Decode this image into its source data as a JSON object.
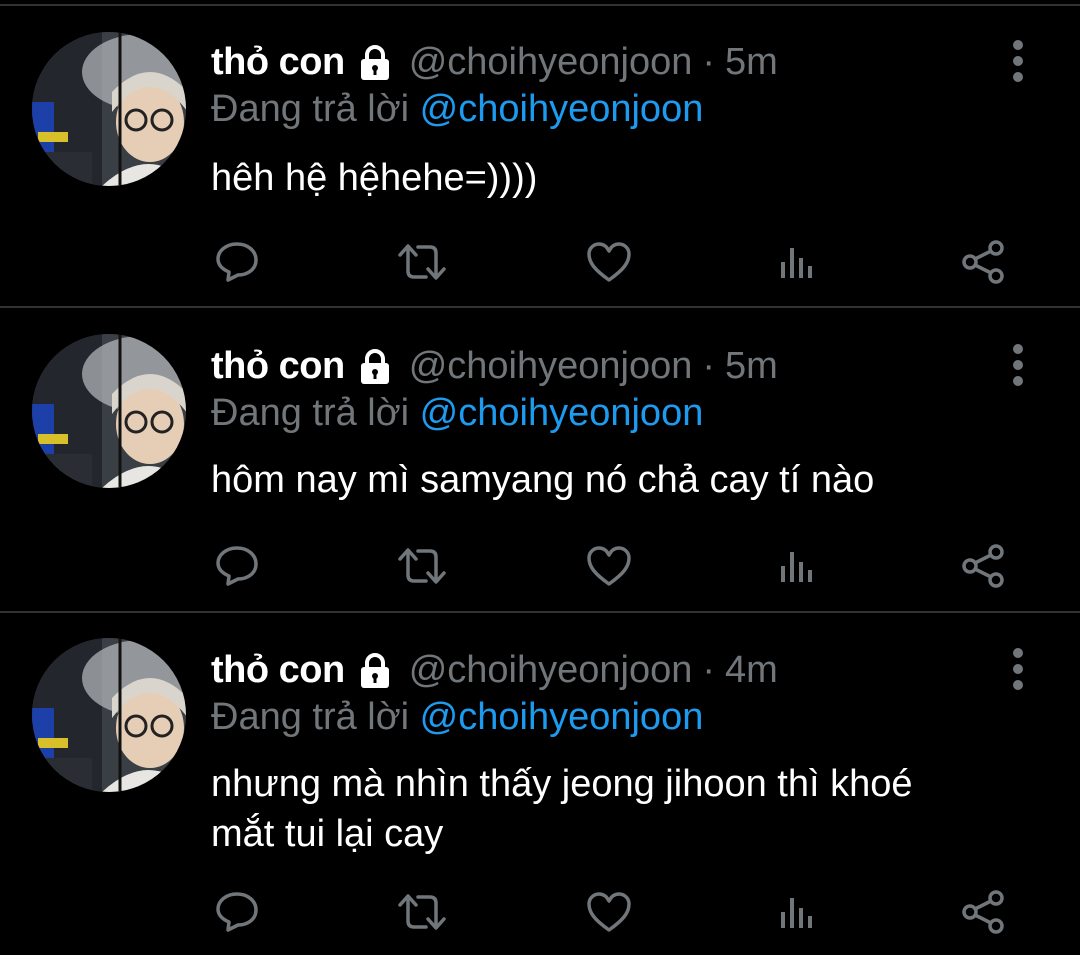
{
  "colors": {
    "background": "#000000",
    "text": "#ffffff",
    "secondary": "#71767b",
    "mention": "#1d9bf0",
    "divider": "#2f3336"
  },
  "icons": {
    "lock": "lock-icon",
    "more": "more-vertical-icon",
    "reply": "reply-icon",
    "retweet": "retweet-icon",
    "like": "heart-icon",
    "views": "views-icon",
    "share": "share-icon"
  },
  "tweets": [
    {
      "display_name": "thỏ con",
      "handle": "@choihyeonjoon",
      "separator": "·",
      "time": "5m",
      "replying_prefix": "Đang trả lời",
      "replying_to": "@choihyeonjoon",
      "text": "hêh hệ hệhehe=))))"
    },
    {
      "display_name": "thỏ con",
      "handle": "@choihyeonjoon",
      "separator": "·",
      "time": "5m",
      "replying_prefix": "Đang trả lời",
      "replying_to": "@choihyeonjoon",
      "text": "hôm nay mì samyang nó chả cay tí nào"
    },
    {
      "display_name": "thỏ con",
      "handle": "@choihyeonjoon",
      "separator": "·",
      "time": "4m",
      "replying_prefix": "Đang trả lời",
      "replying_to": "@choihyeonjoon",
      "text": "nhưng mà nhìn thấy jeong jihoon thì khoé\nmắt tui lại cay"
    }
  ]
}
